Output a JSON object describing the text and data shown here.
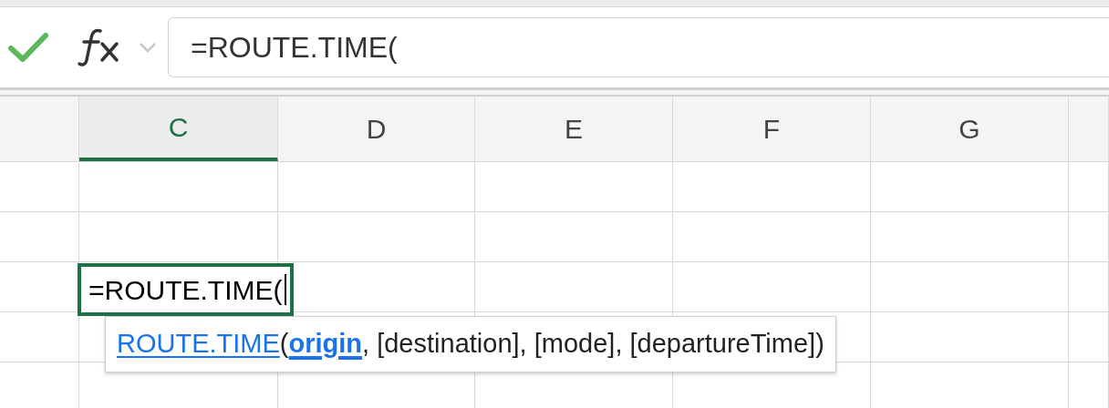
{
  "formula_bar": {
    "value": "=ROUTE.TIME("
  },
  "columns": [
    {
      "selected": false
    },
    {
      "label": "C",
      "selected": true
    },
    {
      "label": "D",
      "selected": false
    },
    {
      "label": "E",
      "selected": false
    },
    {
      "label": "F",
      "selected": false
    },
    {
      "label": "G",
      "selected": false
    },
    {
      "selected": false
    }
  ],
  "active_cell": {
    "value": "=ROUTE.TIME("
  },
  "tooltip": {
    "function": "ROUTE.TIME",
    "open": "(",
    "params": [
      {
        "text": "origin",
        "current": true
      },
      {
        "text": "[destination]",
        "current": false
      },
      {
        "text": "[mode]",
        "current": false
      },
      {
        "text": "[departureTime]",
        "current": false
      }
    ],
    "separator": ", ",
    "close": ")"
  }
}
